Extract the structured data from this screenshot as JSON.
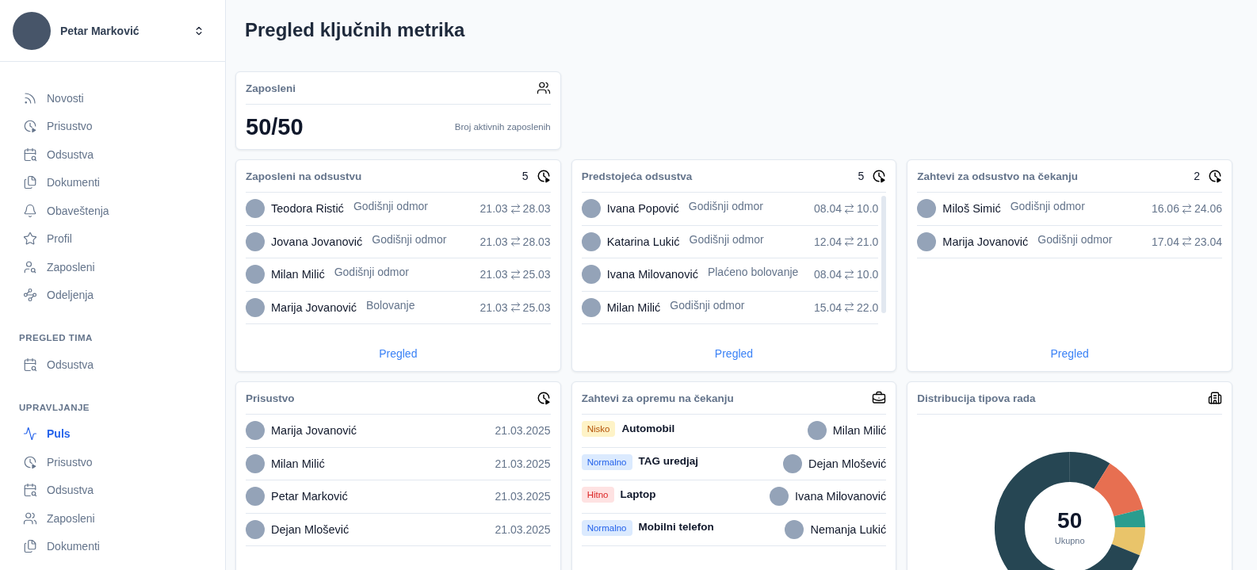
{
  "sidebar": {
    "user": {
      "name": "Petar Marković"
    },
    "items": [
      {
        "kind": "rss",
        "label": "Novosti",
        "selected": false
      },
      {
        "kind": "clock",
        "label": "Prisustvo",
        "selected": false
      },
      {
        "kind": "calendar",
        "label": "Odsustva",
        "selected": false
      },
      {
        "kind": "files",
        "label": "Dokumenti",
        "selected": false
      },
      {
        "kind": "bell",
        "label": "Obaveštenja",
        "selected": false
      },
      {
        "kind": "star",
        "label": "Profil",
        "selected": false
      },
      {
        "kind": "user-search",
        "label": "Zaposleni",
        "selected": false
      },
      {
        "kind": "nodes",
        "label": "Odeljenja",
        "selected": false
      }
    ],
    "sections": [
      {
        "title": "PREGLED TIMA",
        "items": [
          {
            "kind": "calendar",
            "label": "Odsustva",
            "selected": false
          }
        ]
      },
      {
        "title": "UPRAVLJANJE",
        "items": [
          {
            "kind": "pulse",
            "label": "Puls",
            "selected": true
          },
          {
            "kind": "clock",
            "label": "Prisustvo",
            "selected": false
          },
          {
            "kind": "calendar",
            "label": "Odsustva",
            "selected": false
          },
          {
            "kind": "users",
            "label": "Zaposleni",
            "selected": false
          },
          {
            "kind": "files",
            "label": "Dokumenti",
            "selected": false
          }
        ]
      }
    ]
  },
  "page": {
    "title": "Pregled ključnih metrika"
  },
  "employees_card": {
    "title": "Zaposleni",
    "value": "50/50",
    "caption": "Broj aktivnih zaposlenih"
  },
  "leave_cards": [
    {
      "title": "Zaposleni na odsustvu",
      "count": "5",
      "link": "Pregled",
      "scrollbar_visible": false,
      "rows": [
        {
          "name": "Teodora Ristić",
          "type": "Godišnji odmor",
          "from": "21.03",
          "to": "28.03"
        },
        {
          "name": "Jovana Jovanović",
          "type": "Godišnji odmor",
          "from": "21.03",
          "to": "28.03"
        },
        {
          "name": "Milan Milić",
          "type": "Godišnji odmor",
          "from": "21.03",
          "to": "25.03"
        },
        {
          "name": "Marija Jovanović",
          "type": "Bolovanje",
          "from": "21.03",
          "to": "25.03"
        }
      ]
    },
    {
      "title": "Predstojeća odsustva",
      "count": "5",
      "link": "Pregled",
      "scrollbar_visible": true,
      "rows": [
        {
          "name": "Ivana Popović",
          "type": "Godišnji odmor",
          "from": "08.04",
          "to": "10.0"
        },
        {
          "name": "Katarina Lukić",
          "type": "Godišnji odmor",
          "from": "12.04",
          "to": "21.0"
        },
        {
          "name": "Ivana Milovanović",
          "type": "Plaćeno bolovanje",
          "from": "08.04",
          "to": "10.0"
        },
        {
          "name": "Milan Milić",
          "type": "Godišnji odmor",
          "from": "15.04",
          "to": "22.0"
        }
      ]
    },
    {
      "title": "Zahtevi za odsustvo na čekanju",
      "count": "2",
      "link": "Pregled",
      "scrollbar_visible": false,
      "rows": [
        {
          "name": "Miloš Simić",
          "type": "Godišnji odmor",
          "from": "16.06",
          "to": "24.06"
        },
        {
          "name": "Marija Jovanović",
          "type": "Godišnji odmor",
          "from": "17.04",
          "to": "23.04"
        }
      ]
    }
  ],
  "attendance_card": {
    "title": "Prisustvo",
    "rows": [
      {
        "name": "Marija Jovanović",
        "date": "21.03.2025"
      },
      {
        "name": "Milan Milić",
        "date": "21.03.2025"
      },
      {
        "name": "Petar Marković",
        "date": "21.03.2025"
      },
      {
        "name": "Dejan Mlošević",
        "date": "21.03.2025"
      }
    ]
  },
  "equipment_card": {
    "title": "Zahtevi za opremu na čekanju",
    "rows": [
      {
        "priority": {
          "kind": "low",
          "label": "Nisko"
        },
        "item": "Automobil",
        "name": "Milan Milić"
      },
      {
        "priority": {
          "kind": "normal",
          "label": "Normalno"
        },
        "item": "TAG uredjaj",
        "name": "Dejan Mlošević"
      },
      {
        "priority": {
          "kind": "urgent",
          "label": "Hitno"
        },
        "item": "Laptop",
        "name": "Ivana Milovanović"
      },
      {
        "priority": {
          "kind": "normal",
          "label": "Normalno"
        },
        "item": "Mobilni telefon",
        "name": "Nemanja Lukić"
      }
    ]
  },
  "distribution_card": {
    "title": "Distribucija tipova rada",
    "total": "50",
    "total_label": "Ukupno"
  }
}
